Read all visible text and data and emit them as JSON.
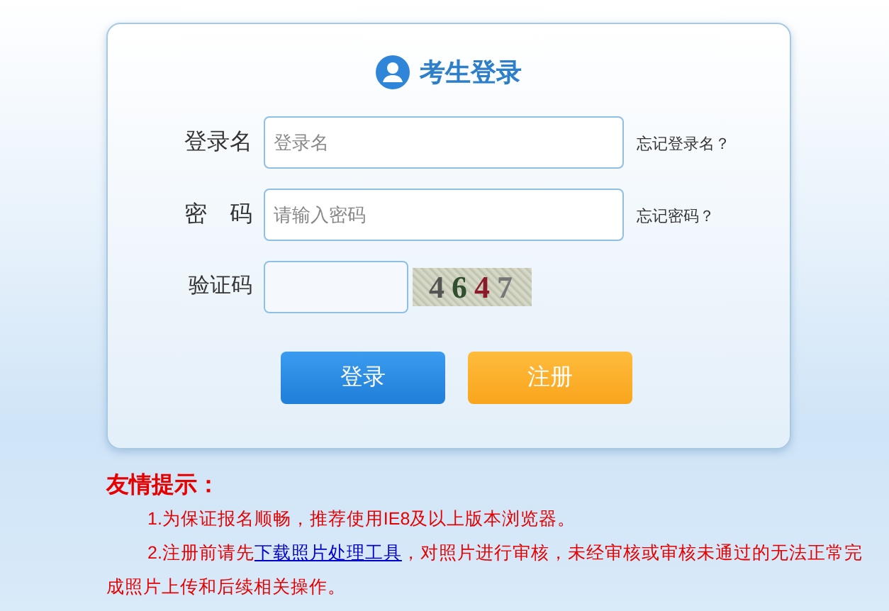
{
  "login_card": {
    "title": "考生登录",
    "fields": [
      {
        "label": "登录名",
        "placeholder": "登录名",
        "link": "忘记登录名？"
      },
      {
        "label": "密　码",
        "placeholder": "请输入密码",
        "link": "忘记密码？"
      }
    ],
    "captcha": {
      "label": "验证码",
      "code": "4647"
    },
    "buttons": [
      {
        "label": "登录",
        "kind": "primary"
      },
      {
        "label": "注册",
        "kind": "secondary"
      }
    ]
  },
  "notice": {
    "heading": "友情提示：",
    "items": [
      {
        "text_before": "1.为保证报名顺畅，推荐使用IE8及以上版本浏览器。"
      },
      {
        "text_before": "2.注册前请先",
        "link": "下载照片处理工具",
        "text_after": "，对照片进行审核，未经审核或审核未通过的无法正常完成照片上传和后续相关操作。"
      }
    ]
  }
}
